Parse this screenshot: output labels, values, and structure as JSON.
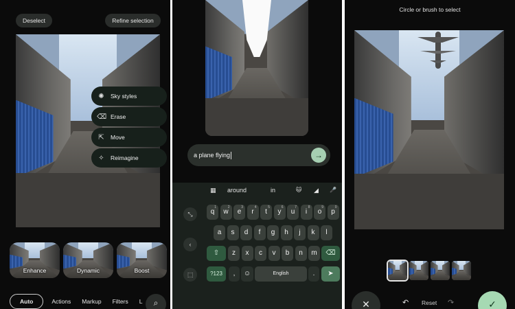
{
  "panel1": {
    "deselect_label": "Deselect",
    "refine_label": "Refine selection",
    "menu": [
      {
        "label": "Sky styles",
        "icon": "sky-styles-icon",
        "glyph": "✺"
      },
      {
        "label": "Erase",
        "icon": "erase-icon",
        "glyph": "⌫"
      },
      {
        "label": "Move",
        "icon": "move-icon",
        "glyph": "⇱"
      },
      {
        "label": "Reimagine",
        "icon": "reimagine-icon",
        "glyph": "✧"
      }
    ],
    "presets": [
      {
        "label": "Enhance"
      },
      {
        "label": "Dynamic"
      },
      {
        "label": "Boost"
      }
    ],
    "tabs": [
      "Auto",
      "Actions",
      "Markup",
      "Filters",
      "L"
    ],
    "search_glyph": "⌕"
  },
  "panel2": {
    "prompt_text": "a plane flying",
    "send_glyph": "→",
    "suggestions": [
      "around",
      "in"
    ],
    "suggest_icons": {
      "apps": "▦",
      "emoji": "🐱",
      "theme": "◢",
      "mic": "🎤"
    },
    "row1": [
      [
        "q",
        "1"
      ],
      [
        "w",
        "2"
      ],
      [
        "e",
        "3"
      ],
      [
        "r",
        "4"
      ],
      [
        "t",
        "5"
      ],
      [
        "y",
        "6"
      ],
      [
        "u",
        "7"
      ],
      [
        "i",
        "8"
      ],
      [
        "o",
        "9"
      ],
      [
        "p",
        "0"
      ]
    ],
    "row2": [
      "a",
      "s",
      "d",
      "f",
      "g",
      "h",
      "j",
      "k",
      "l"
    ],
    "row3": [
      "z",
      "x",
      "c",
      "v",
      "b",
      "n",
      "m"
    ],
    "keys": {
      "shift": "⇧",
      "backspace": "⌫",
      "symbols": "?123",
      "comma": ",",
      "emoji": "☺",
      "space": "English",
      "period": ".",
      "enter": "➤"
    },
    "side_glyphs": {
      "expand": "⤡",
      "back": "‹",
      "select": "⬚"
    }
  },
  "panel3": {
    "instruction": "Circle or brush to select",
    "cancel_glyph": "✕",
    "undo_glyph": "↶",
    "reset_label": "Reset",
    "redo_glyph": "↷",
    "confirm_glyph": "✓",
    "accent_color": "#a6d9b3",
    "variant_count": 4
  }
}
